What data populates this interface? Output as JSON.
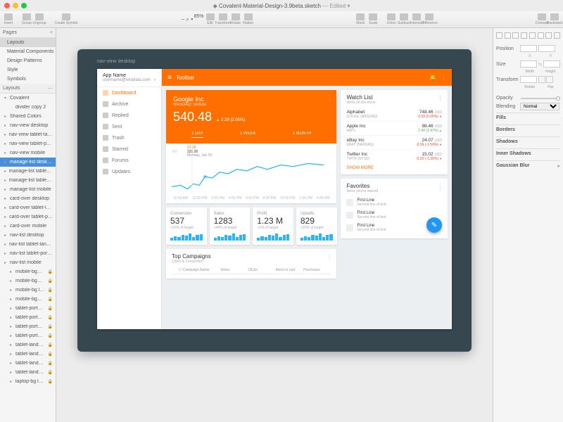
{
  "window": {
    "title": "Covalent-Material-Design-3.9beta.sketch",
    "edited": "— Edited ▾"
  },
  "toolbar": {
    "insert": "Insert",
    "group": "Group",
    "ungroup": "Ungroup",
    "create_symbol": "Create Symbol",
    "zoom_pct": "85%",
    "edit": "Edit",
    "transform": "Transform",
    "rotate": "Rotate",
    "flatten": "Flatten",
    "mask": "Mask",
    "scale": "Scale",
    "union": "Union",
    "subtract": "Subtract",
    "intersect": "Intersect",
    "difference": "Difference",
    "forward": "Forward",
    "backward": "Backward"
  },
  "pages": {
    "header": "Pages",
    "items": [
      "Layouts",
      "Material Components",
      "Design Patterns",
      "Style",
      "Symbols"
    ],
    "selected": 0
  },
  "layers": {
    "header": "Layouts",
    "items": [
      {
        "label": "Covalent",
        "locked": false,
        "depth": 0,
        "tri": "▾"
      },
      {
        "label": "divider copy 2",
        "locked": false,
        "depth": 1,
        "tri": ""
      },
      {
        "label": "Shared Colors",
        "locked": false,
        "depth": 0,
        "tri": "▸"
      },
      {
        "label": "nav-view desktop",
        "locked": false,
        "depth": 0,
        "tri": "▸"
      },
      {
        "label": "nav-view tablet-landsc…",
        "locked": false,
        "depth": 0,
        "tri": "▸"
      },
      {
        "label": "nav-view tablet-portrait",
        "locked": false,
        "depth": 0,
        "tri": "▸"
      },
      {
        "label": "nav-view mobile",
        "locked": false,
        "depth": 0,
        "tri": "▸"
      },
      {
        "label": "manage-list desktop",
        "locked": false,
        "depth": 0,
        "tri": "▸",
        "sel": true
      },
      {
        "label": "manage-list tablet-land…",
        "locked": false,
        "depth": 0,
        "tri": "▸"
      },
      {
        "label": "manage-list tablet-port…",
        "locked": false,
        "depth": 0,
        "tri": "▸"
      },
      {
        "label": "manage-list mobile",
        "locked": false,
        "depth": 0,
        "tri": "▸"
      },
      {
        "label": "card-over desktop",
        "locked": false,
        "depth": 0,
        "tri": "▸"
      },
      {
        "label": "card-over tablet-lands…",
        "locked": false,
        "depth": 0,
        "tri": "▸"
      },
      {
        "label": "card-over tablet-portr…",
        "locked": false,
        "depth": 0,
        "tri": "▸"
      },
      {
        "label": "card-over mobile",
        "locked": false,
        "depth": 0,
        "tri": "▸"
      },
      {
        "label": "nav-list desktop",
        "locked": false,
        "depth": 0,
        "tri": "▸"
      },
      {
        "label": "nav-list tablet-landsca…",
        "locked": false,
        "depth": 0,
        "tri": "▸"
      },
      {
        "label": "nav-list tablet-portrait",
        "locked": false,
        "depth": 0,
        "tri": "▸"
      },
      {
        "label": "nav-list mobile",
        "locked": false,
        "depth": 0,
        "tri": "▸"
      },
      {
        "label": "mobile-bg…",
        "locked": true,
        "depth": 1,
        "tri": "▸"
      },
      {
        "label": "mobile-bg…",
        "locked": true,
        "depth": 1,
        "tri": "▸"
      },
      {
        "label": "mobile-bg l…",
        "locked": true,
        "depth": 1,
        "tri": "▸"
      },
      {
        "label": "mobile-bg…",
        "locked": true,
        "depth": 1,
        "tri": "▸"
      },
      {
        "label": "tablet-port…",
        "locked": true,
        "depth": 1,
        "tri": "▸"
      },
      {
        "label": "tablet-port…",
        "locked": true,
        "depth": 1,
        "tri": "▸"
      },
      {
        "label": "tablet-port…",
        "locked": true,
        "depth": 1,
        "tri": "▸"
      },
      {
        "label": "tablet-port…",
        "locked": true,
        "depth": 1,
        "tri": "▸"
      },
      {
        "label": "tablet-land…",
        "locked": true,
        "depth": 1,
        "tri": "▸"
      },
      {
        "label": "tablet-land…",
        "locked": true,
        "depth": 1,
        "tri": "▸"
      },
      {
        "label": "tablet-land…",
        "locked": true,
        "depth": 1,
        "tri": "▸"
      },
      {
        "label": "tablet-land…",
        "locked": true,
        "depth": 1,
        "tri": "▸"
      },
      {
        "label": "laptop-bg l…",
        "locked": true,
        "depth": 1,
        "tri": "▸"
      }
    ]
  },
  "inspector": {
    "position": "Position",
    "x": "X",
    "y": "Y",
    "size": "Size",
    "width": "Width",
    "height": "Height",
    "transform": "Transform",
    "rotate": "Rotate",
    "flip": "Flip",
    "opacity": "Opacity",
    "blending": "Blending",
    "blend_mode": "Normal",
    "fills": "Fills",
    "borders": "Borders",
    "shadows": "Shadows",
    "inner_shadows": "Inner Shadows",
    "gaussian": "Gaussian Blur"
  },
  "artboard": {
    "label": "nav-view desktop",
    "app_name": "App Name",
    "username": "username@teradata.com",
    "nav": [
      "Dashboard",
      "Archive",
      "Replied",
      "Sent",
      "Trash",
      "Starred",
      "Forums",
      "Updates"
    ],
    "nav_active": 0,
    "toolbar_title": "Toolbar",
    "hero": {
      "name": "Google Inc",
      "ticker": "NASDAQ: GOOG",
      "price": "540.48",
      "delta": "2.29 (2.05%)",
      "tabs": [
        "1 DAY",
        "1 WEEK",
        "1 MONTH"
      ],
      "active_tab": 0
    },
    "chart": {
      "y_top": "360",
      "tooltip_time": "21:25",
      "tooltip_price": "331.00",
      "tooltip_date": "Monday, Jun 29",
      "x": [
        "10:00 AM",
        "12:00 PM",
        "2:00 PM",
        "4:00 PM",
        "6:00 PM",
        "8:00 PM",
        "10:00 PM",
        "1:00 PM",
        "4:00 PM"
      ]
    },
    "tiles": [
      {
        "label": "Conversion",
        "value": "537",
        "sub": "+22% of target"
      },
      {
        "label": "Sales",
        "value": "1283",
        "sub": "+48% of target"
      },
      {
        "label": "Profit",
        "value": "1.23 M",
        "sub": "+1% of target"
      },
      {
        "label": "Upsells",
        "value": "829",
        "sub": "+30% of target"
      }
    ],
    "campaigns": {
      "title": "Top Campaigns",
      "sub": "Clicks & Conversion",
      "cols": [
        "Campaign Name",
        "Views",
        "Clicks",
        "Items in cart",
        "Purchases"
      ]
    },
    "watch": {
      "title": "Watch List",
      "sub": "Items on the move",
      "items": [
        {
          "name": "Alphabet",
          "tick": "GOOGL (NASDAQ)",
          "price": "748.46",
          "delta": "0.09 (0.05%)",
          "dir": "dn"
        },
        {
          "name": "Apple Inc",
          "tick": "AAPL",
          "price": "98.46",
          "delta": "1.40 (1.47%)",
          "dir": "up"
        },
        {
          "name": "eBay Inc",
          "tick": "EBAY (NASDAQ)",
          "price": "24.07",
          "delta": "-0.39 (-1.59%)",
          "dir": "dn"
        },
        {
          "name": "Twitter Inc",
          "tick": "TWTR (NYSE)",
          "price": "15.02",
          "delta": "-0.20 (-1.35%)",
          "dir": "dn"
        }
      ],
      "more": "SHOW MORE"
    },
    "favorites": {
      "title": "Favorites",
      "sub": "Items you've starred",
      "items": [
        {
          "l1": "First Line",
          "l2": "Second line of text"
        },
        {
          "l1": "First Line",
          "l2": "Second line of text"
        },
        {
          "l1": "First Line",
          "l2": "Second line of text"
        }
      ]
    }
  }
}
